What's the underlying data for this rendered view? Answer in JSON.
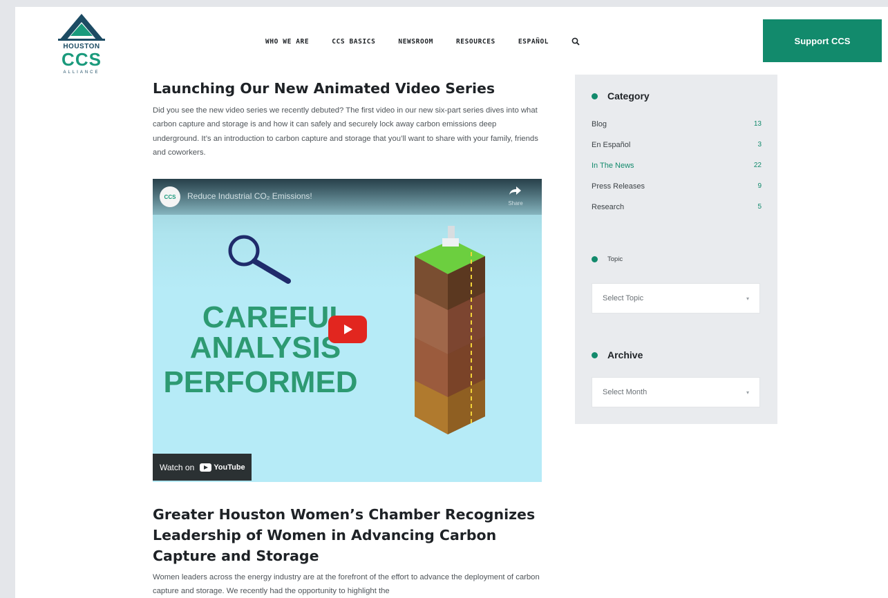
{
  "header": {
    "logo": {
      "line1": "HOUSTON",
      "line2": "CCS",
      "line3": "ALLIANCE"
    },
    "nav": [
      {
        "label": "WHO WE ARE"
      },
      {
        "label": "CCS BASICS"
      },
      {
        "label": "NEWSROOM"
      },
      {
        "label": "RESOURCES"
      },
      {
        "label": "ESPAÑOL"
      }
    ],
    "search_icon": "search-icon",
    "cta_label": "Support CCS"
  },
  "posts": [
    {
      "title": "Launching Our New Animated Video Series",
      "excerpt": "Did you see the new video series we recently debuted? The first video in our new six-part series dives into what carbon capture and storage is and how it can safely and securely lock away carbon emissions deep underground. It’s an introduction to carbon capture and storage that you’ll want to share with your family, friends and coworkers."
    },
    {
      "title": "Greater Houston Women’s Chamber Recognizes Leadership of Women in Advancing Carbon Capture and Storage",
      "excerpt": "Women leaders across the energy industry are at the forefront of the effort to advance the deployment of carbon capture and storage. We recently had the opportunity to highlight the"
    }
  ],
  "video": {
    "channel_icon_text": "CCS",
    "title": "Reduce Industrial CO₂ Emissions!",
    "share_label": "Share",
    "text_lines": [
      "CAREFUL",
      "ANALYSIS",
      "PERFORMED"
    ],
    "watch_on": "Watch on",
    "youtube_label": "YouTube"
  },
  "sidebar": {
    "category": {
      "title": "Category",
      "items": [
        {
          "name": "Blog",
          "count": "13"
        },
        {
          "name": "En Español",
          "count": "3"
        },
        {
          "name": "In The News",
          "count": "22"
        },
        {
          "name": "Press Releases",
          "count": "9"
        },
        {
          "name": "Research",
          "count": "5"
        }
      ]
    },
    "topic": {
      "title": "Topic",
      "placeholder": "Select Topic"
    },
    "archive": {
      "title": "Archive",
      "placeholder": "Select Month"
    }
  },
  "colors": {
    "brand_green": "#128a6c",
    "logo_navy": "#1c4b63",
    "youtube_red": "#e2261f"
  }
}
